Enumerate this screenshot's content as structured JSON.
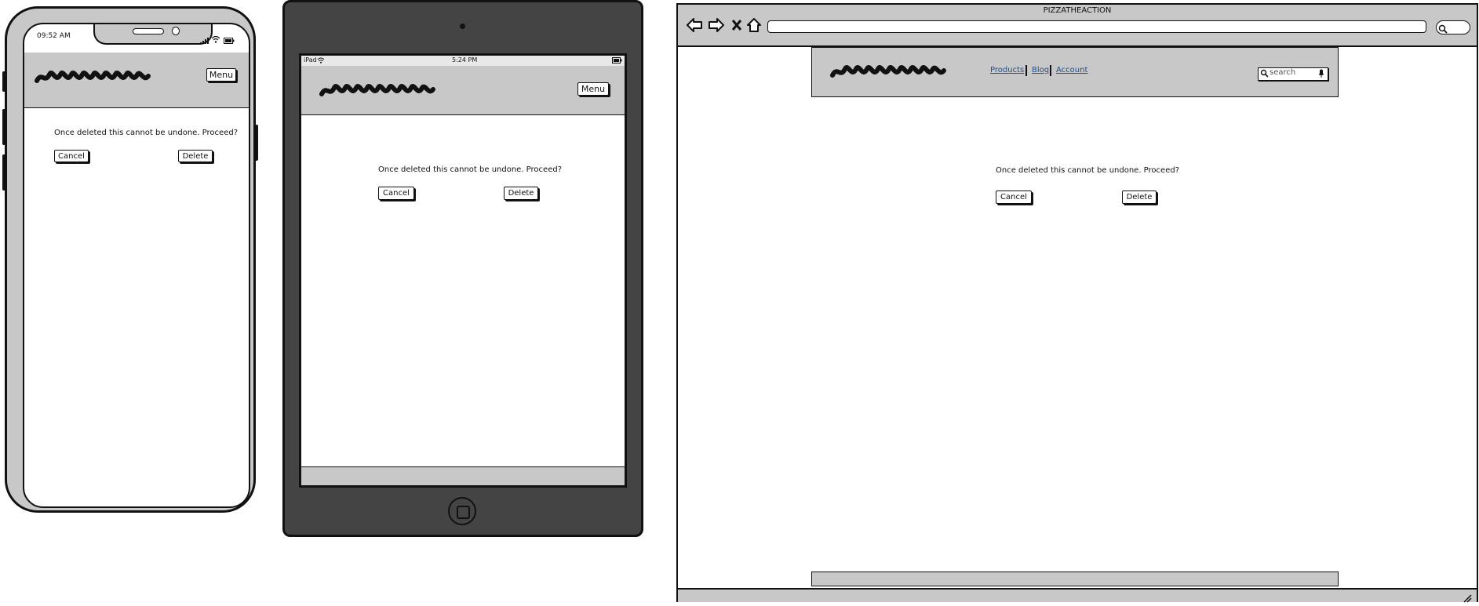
{
  "phone": {
    "time": "09:52 AM",
    "menu_label": "Menu",
    "confirm_text": "Once deleted this cannot be undone. Proceed?",
    "cancel_label": "Cancel",
    "delete_label": "Delete"
  },
  "tablet": {
    "carrier": "iPad",
    "time": "5:24 PM",
    "menu_label": "Menu",
    "confirm_text": "Once deleted this cannot be undone. Proceed?",
    "cancel_label": "Cancel",
    "delete_label": "Delete"
  },
  "browser": {
    "title": "PIZZATHEACTION",
    "nav": [
      "Products",
      "Blog",
      "Account"
    ],
    "search_placeholder": "search",
    "confirm_text": "Once deleted this cannot be undone. Proceed?",
    "cancel_label": "Cancel",
    "delete_label": "Delete"
  },
  "icons": [
    "back-arrow-icon",
    "forward-arrow-icon",
    "close-icon",
    "home-icon",
    "search-icon",
    "microphone-icon",
    "wifi-icon",
    "battery-icon",
    "signal-icon",
    "home-button-icon",
    "resize-grip-icon"
  ],
  "colors": {
    "frame_gray": "#c8c8c8",
    "tablet_body": "#444444",
    "link": "#1a4f9c"
  }
}
